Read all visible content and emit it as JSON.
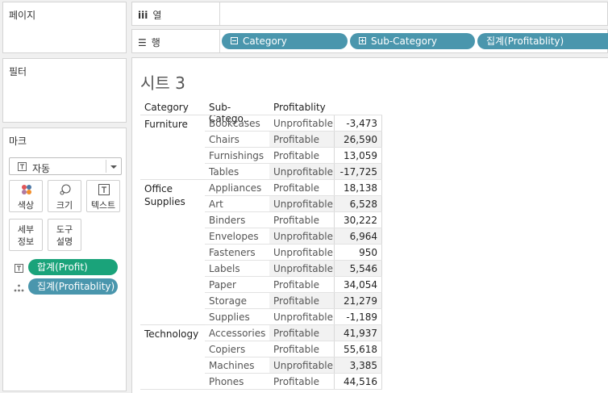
{
  "panels": {
    "pages": "페이지",
    "filters": "필터",
    "marks": "마크"
  },
  "marks": {
    "mark_type": "자동",
    "buttons": {
      "color": "색상",
      "size": "크기",
      "text": "텍스트",
      "detail": "세부\n정보",
      "tooltip": "도구\n설명"
    },
    "pills": {
      "text_field": "합계(Profit)",
      "detail_field": "집계(Profitablity)"
    },
    "colors": {
      "green": "#1aa37a",
      "blue": "#4a96ad"
    }
  },
  "shelves": {
    "columns_label": "열",
    "rows_label": "행",
    "rows_pills": [
      "Category",
      "Sub-Category",
      "집계(Profitablity)"
    ]
  },
  "sheet": {
    "title": "시트 3",
    "headers": {
      "category": "Category",
      "subcategory": "Sub-Catego..",
      "profitability": "Profitablity"
    },
    "groups": [
      {
        "category": "Furniture",
        "rows": [
          {
            "sub": "Bookcases",
            "status": "Unprofitable",
            "value": "-3,473"
          },
          {
            "sub": "Chairs",
            "status": "Profitable",
            "value": "26,590"
          },
          {
            "sub": "Furnishings",
            "status": "Profitable",
            "value": "13,059"
          },
          {
            "sub": "Tables",
            "status": "Unprofitable",
            "value": "-17,725"
          }
        ]
      },
      {
        "category": "Office Supplies",
        "rows": [
          {
            "sub": "Appliances",
            "status": "Profitable",
            "value": "18,138"
          },
          {
            "sub": "Art",
            "status": "Unprofitable",
            "value": "6,528"
          },
          {
            "sub": "Binders",
            "status": "Profitable",
            "value": "30,222"
          },
          {
            "sub": "Envelopes",
            "status": "Unprofitable",
            "value": "6,964"
          },
          {
            "sub": "Fasteners",
            "status": "Unprofitable",
            "value": "950"
          },
          {
            "sub": "Labels",
            "status": "Unprofitable",
            "value": "5,546"
          },
          {
            "sub": "Paper",
            "status": "Profitable",
            "value": "34,054"
          },
          {
            "sub": "Storage",
            "status": "Profitable",
            "value": "21,279"
          },
          {
            "sub": "Supplies",
            "status": "Unprofitable",
            "value": "-1,189"
          }
        ]
      },
      {
        "category": "Technology",
        "rows": [
          {
            "sub": "Accessories",
            "status": "Profitable",
            "value": "41,937"
          },
          {
            "sub": "Copiers",
            "status": "Profitable",
            "value": "55,618"
          },
          {
            "sub": "Machines",
            "status": "Unprofitable",
            "value": "3,385"
          },
          {
            "sub": "Phones",
            "status": "Profitable",
            "value": "44,516"
          }
        ]
      }
    ]
  }
}
